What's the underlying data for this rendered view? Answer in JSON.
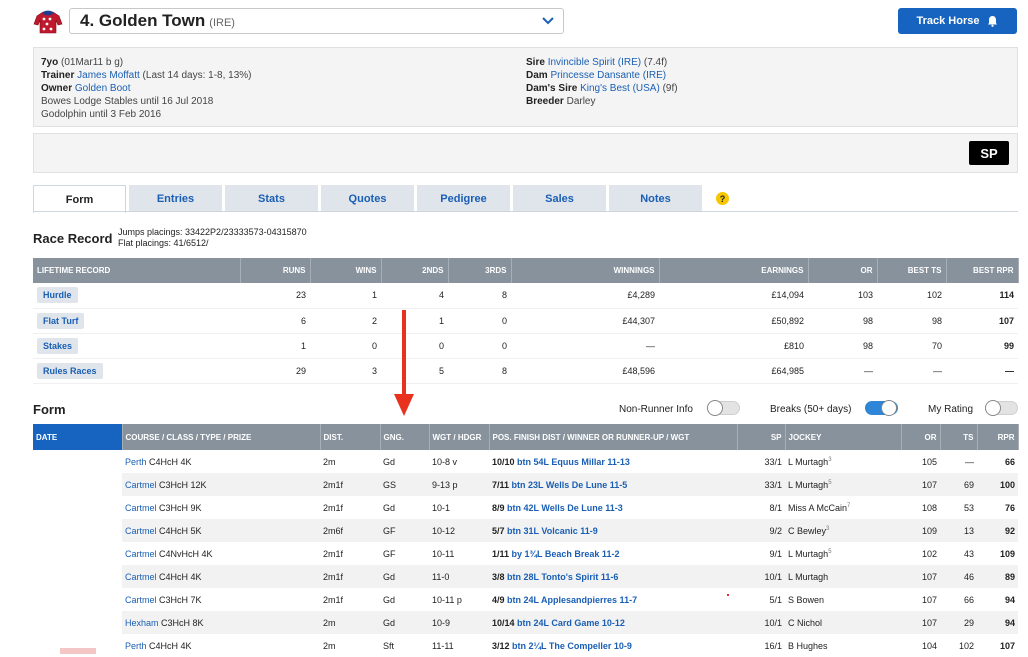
{
  "header": {
    "horse_name": "4. Golden Town",
    "horse_country": "(IRE)",
    "track_button": "Track Horse"
  },
  "info": {
    "left": {
      "age_label": "7yo",
      "age_detail": "(01Mar11 b g)",
      "trainer_label": "Trainer",
      "trainer_name": "James Moffatt",
      "trainer_stats": "(Last 14 days: 1-8, 13%)",
      "owner_label": "Owner",
      "owner_name": "Golden Boot",
      "history1": "Bowes Lodge Stables until 16 Jul 2018",
      "history2": "Godolphin until 3 Feb 2016"
    },
    "right": {
      "sire_label": "Sire",
      "sire_name": "Invincible Spirit",
      "sire_cty": "(IRE)",
      "sire_dist": "(7.4f)",
      "dam_label": "Dam",
      "dam_name": "Princesse Dansante",
      "dam_cty": "(IRE)",
      "damsire_label": "Dam's Sire",
      "damsire_name": "King's Best",
      "damsire_cty": "(USA)",
      "damsire_dist": "(9f)",
      "breeder_label": "Breeder",
      "breeder_name": "Darley"
    }
  },
  "sp_button": "SP",
  "tabs": [
    "Form",
    "Entries",
    "Stats",
    "Quotes",
    "Pedigree",
    "Sales",
    "Notes"
  ],
  "help_icon": "?",
  "race_record": {
    "title": "Race Record",
    "jumps_placings": "Jumps placings: 33422P2/23333573-04315870",
    "flat_placings": "Flat placings: 41/6512/",
    "headers": [
      "LIFETIME RECORD",
      "RUNS",
      "WINS",
      "2NDS",
      "3RDS",
      "WINNINGS",
      "EARNINGS",
      "OR",
      "BEST TS",
      "BEST RPR"
    ],
    "rows": [
      [
        "Hurdle",
        "23",
        "1",
        "4",
        "8",
        "£4,289",
        "£14,094",
        "103",
        "102",
        "114"
      ],
      [
        "Flat Turf",
        "6",
        "2",
        "1",
        "0",
        "£44,307",
        "£50,892",
        "98",
        "98",
        "107"
      ],
      [
        "Stakes",
        "1",
        "0",
        "0",
        "0",
        "—",
        "£810",
        "98",
        "70",
        "99"
      ],
      [
        "Rules Races",
        "29",
        "3",
        "5",
        "8",
        "£48,596",
        "£64,985",
        "—",
        "—",
        "—"
      ]
    ]
  },
  "form": {
    "title": "Form",
    "toggles": [
      {
        "label": "Non-Runner Info",
        "on": false
      },
      {
        "label": "Breaks (50+ days)",
        "on": true
      },
      {
        "label": "My Rating",
        "on": false
      }
    ],
    "headers": [
      "DATE",
      "COURSE / CLASS / TYPE / PRIZE",
      "DIST.",
      "GNG.",
      "WGT / HDGR",
      "POS. FINISH DIST / WINNER OR RUNNER-UP / WGT",
      "SP",
      "JOCKEY",
      "OR",
      "TS",
      "RPR"
    ],
    "rows": [
      {
        "course": "Perth",
        "detail": "C4HcH 4K",
        "dist": "2m",
        "going": "Gd",
        "wgt": "10-8 v",
        "pos": "10/10",
        "result": "btn 54L Equus Millar 11-13",
        "sp": "33/1",
        "jockey": "L Murtagh",
        "jsup": "3",
        "or": "105",
        "ts": "—",
        "rpr": "66"
      },
      {
        "course": "Cartmel",
        "detail": "C3HcH 12K",
        "dist": "2m1f",
        "going": "GS",
        "wgt": "9-13 p",
        "pos": "7/11",
        "result": "btn 23L Wells De Lune 11-5",
        "sp": "33/1",
        "jockey": "L Murtagh",
        "jsup": "5",
        "or": "107",
        "ts": "69",
        "rpr": "100"
      },
      {
        "course": "Cartmel",
        "detail": "C3HcH 9K",
        "dist": "2m1f",
        "going": "Gd",
        "wgt": "10-1",
        "pos": "8/9",
        "result": "btn 42L Wells De Lune 11-3",
        "sp": "8/1",
        "jockey": "Miss A McCain",
        "jsup": "7",
        "or": "108",
        "ts": "53",
        "rpr": "76"
      },
      {
        "course": "Cartmel",
        "detail": "C4HcH 5K",
        "dist": "2m6f",
        "going": "GF",
        "wgt": "10-12",
        "pos": "5/7",
        "result": "btn 31L Volcanic 11-9",
        "sp": "9/2",
        "jockey": "C Bewley",
        "jsup": "3",
        "or": "109",
        "ts": "13",
        "rpr": "92"
      },
      {
        "course": "Cartmel",
        "detail": "C4NvHcH 4K",
        "dist": "2m1f",
        "going": "GF",
        "wgt": "10-11",
        "pos": "1/11",
        "result": "by 1¾L Beach Break 11-2",
        "sp": "9/1",
        "jockey": "L Murtagh",
        "jsup": "5",
        "or": "102",
        "ts": "43",
        "rpr": "109"
      },
      {
        "course": "Cartmel",
        "detail": "C4HcH 4K",
        "dist": "2m1f",
        "going": "Gd",
        "wgt": "11-0",
        "pos": "3/8",
        "result": "btn 28L Tonto's Spirit 11-6",
        "sp": "10/1",
        "jockey": "L Murtagh",
        "jsup": "",
        "or": "107",
        "ts": "46",
        "rpr": "89"
      },
      {
        "course": "Cartmel",
        "detail": "C3HcH 7K",
        "dist": "2m1f",
        "going": "Gd",
        "wgt": "10-11 p",
        "pos": "4/9",
        "result": "btn 24L Applesandpierres 11-7",
        "sp": "5/1",
        "jockey": "S Bowen",
        "jsup": "",
        "or": "107",
        "ts": "66",
        "rpr": "94"
      },
      {
        "course": "Hexham",
        "detail": "C3HcH 8K",
        "dist": "2m",
        "going": "Gd",
        "wgt": "10-9",
        "pos": "10/14",
        "result": "btn 24L Card Game 10-12",
        "sp": "10/1",
        "jockey": "C Nichol",
        "jsup": "",
        "or": "107",
        "ts": "29",
        "rpr": "94"
      },
      {
        "course": "Perth",
        "detail": "C4HcH 4K",
        "dist": "2m",
        "going": "Sft",
        "wgt": "11-11",
        "pos": "3/12",
        "result": "btn 2¼L The Compeller 10-9",
        "sp": "16/1",
        "jockey": "B Hughes",
        "jsup": "",
        "or": "104",
        "ts": "102",
        "rpr": "107"
      }
    ]
  },
  "colors": {
    "accent": "#1764c0",
    "header_grey": "#87929c",
    "annotation_red": "#e8321e"
  }
}
